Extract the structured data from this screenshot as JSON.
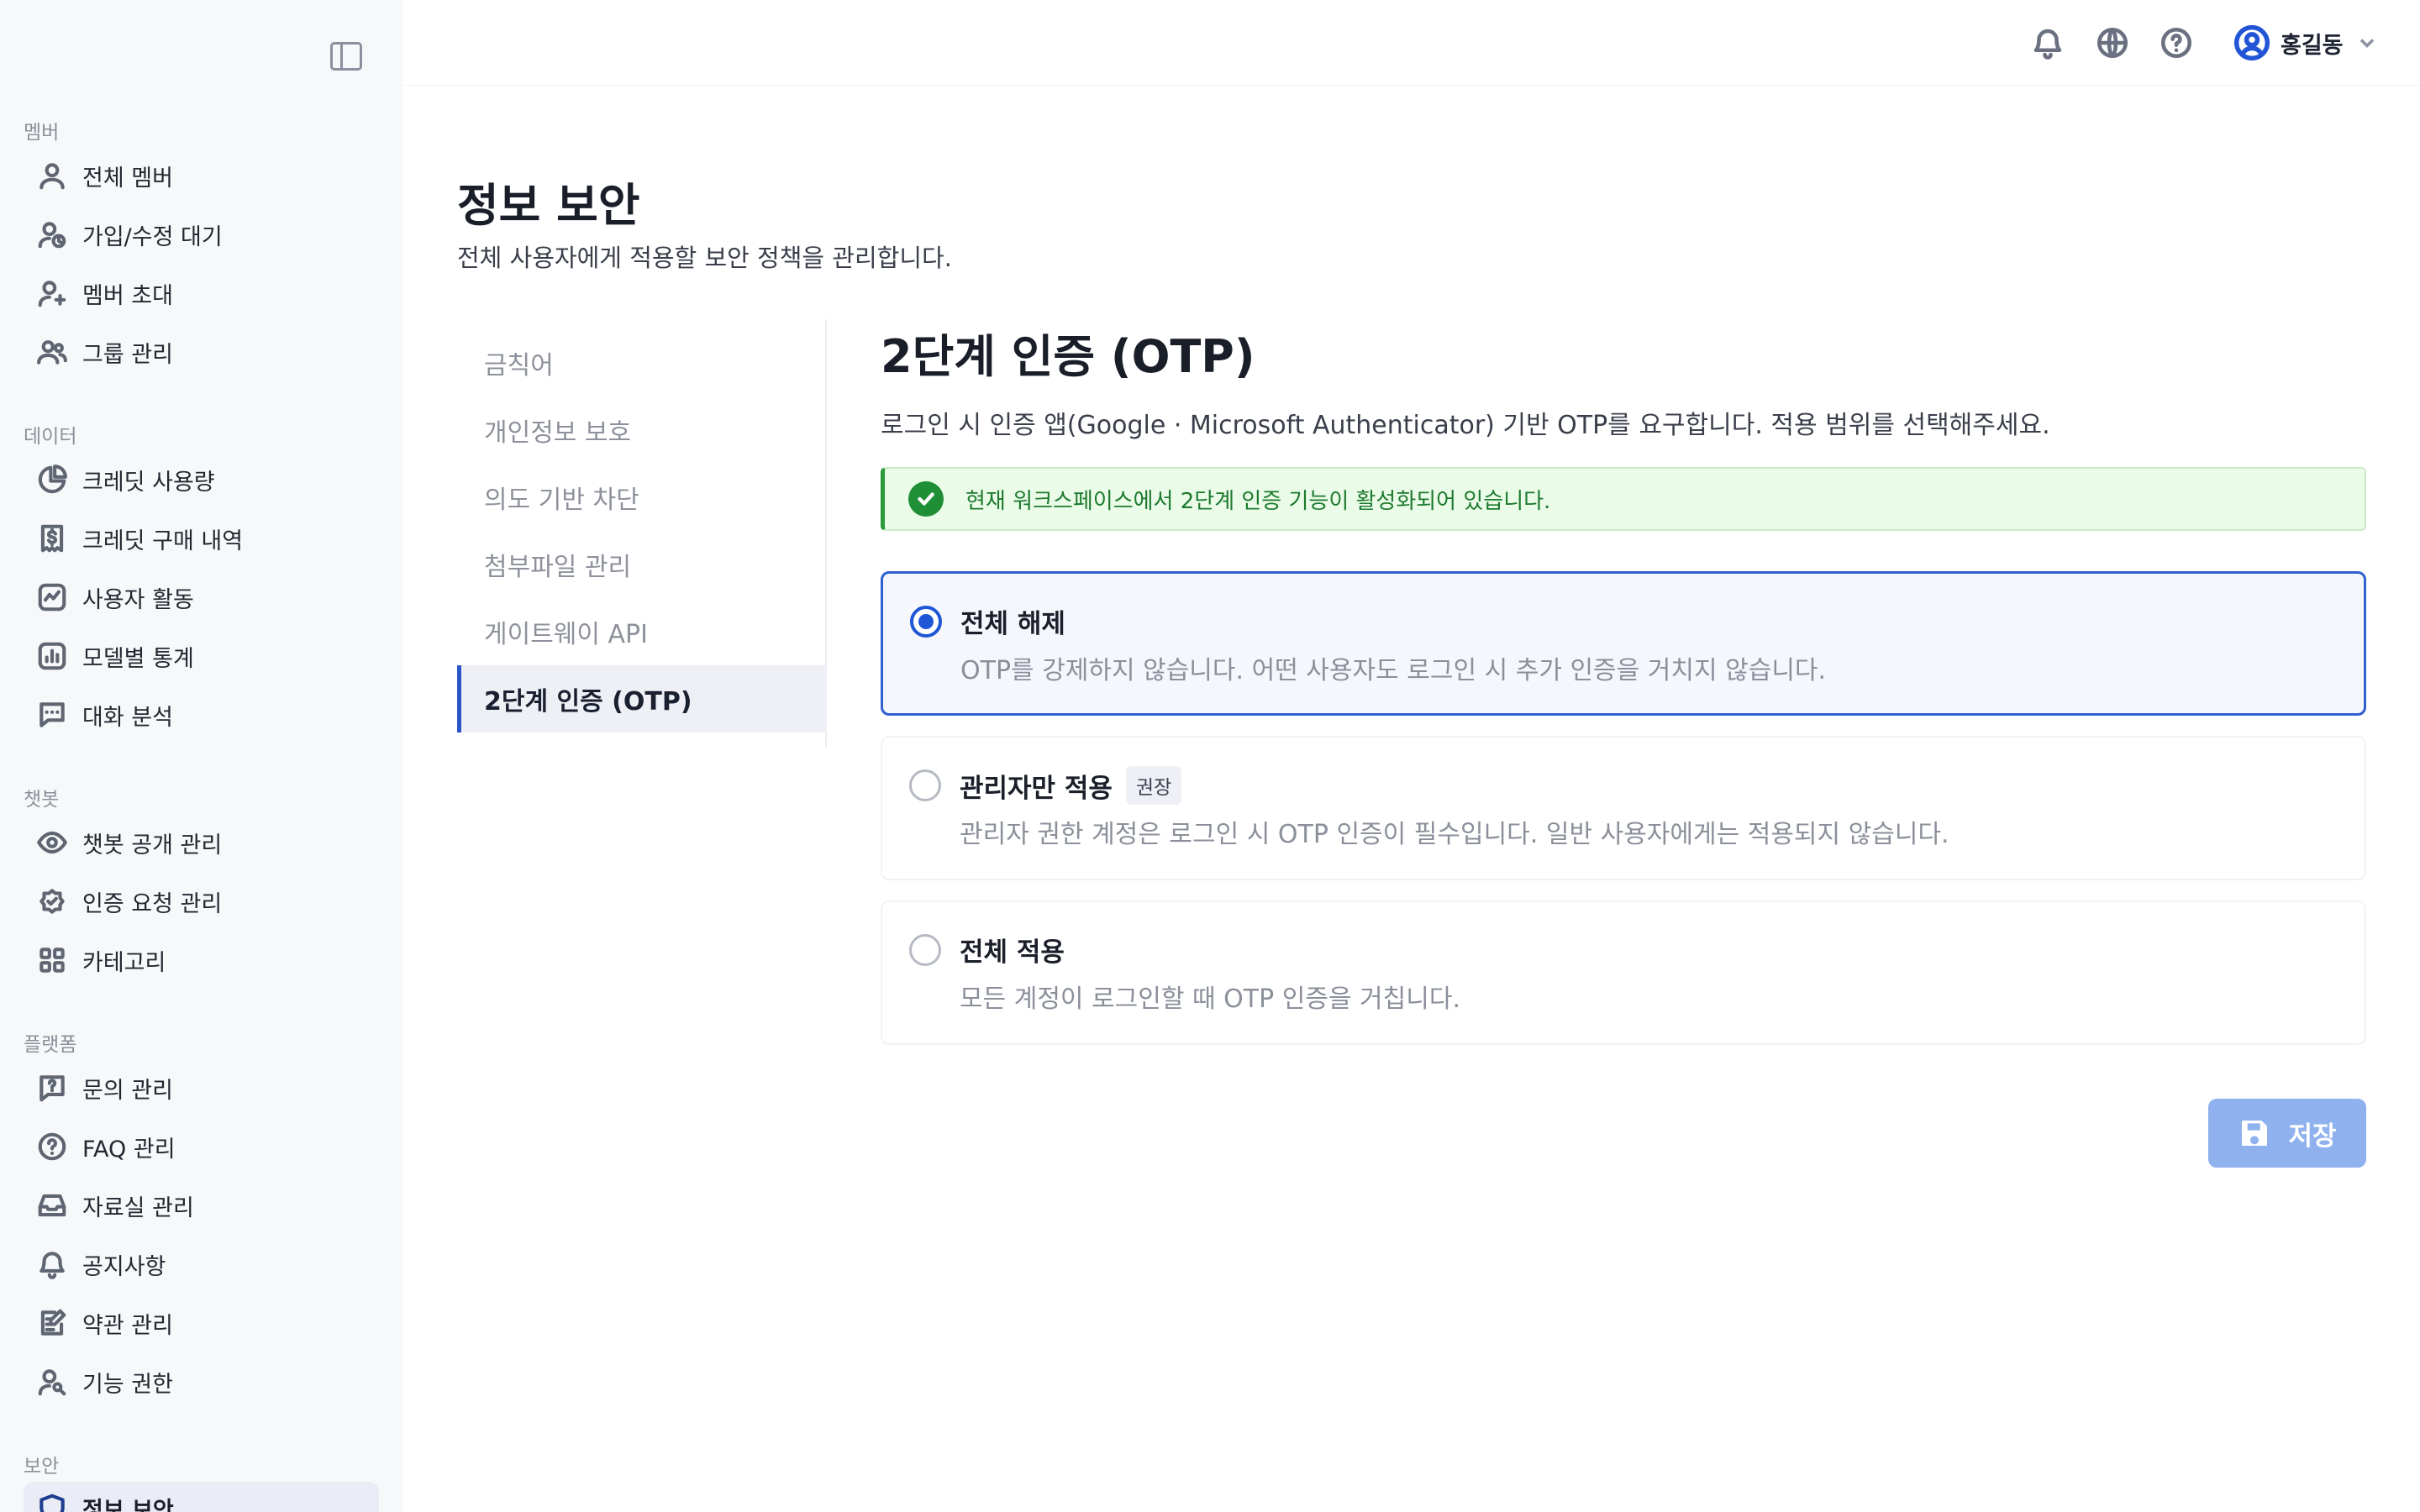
{
  "sidebar": {
    "sections": [
      {
        "title": "멤버",
        "items": [
          {
            "label": "전체 멤버",
            "icon": "user-icon"
          },
          {
            "label": "가입/수정 대기",
            "icon": "user-clock-icon"
          },
          {
            "label": "멤버 초대",
            "icon": "user-plus-icon"
          },
          {
            "label": "그룹 관리",
            "icon": "users-icon"
          }
        ]
      },
      {
        "title": "데이터",
        "items": [
          {
            "label": "크레딧 사용량",
            "icon": "pie-chart-icon"
          },
          {
            "label": "크레딧 구매 내역",
            "icon": "receipt-dollar-icon"
          },
          {
            "label": "사용자 활동",
            "icon": "activity-icon"
          },
          {
            "label": "모델별 통계",
            "icon": "bar-chart-icon"
          },
          {
            "label": "대화 분석",
            "icon": "chat-analysis-icon"
          }
        ]
      },
      {
        "title": "챗봇",
        "items": [
          {
            "label": "챗봇 공개 관리",
            "icon": "eye-icon"
          },
          {
            "label": "인증 요청 관리",
            "icon": "badge-check-icon"
          },
          {
            "label": "카테고리",
            "icon": "grid-icon"
          }
        ]
      },
      {
        "title": "플랫폼",
        "items": [
          {
            "label": "문의 관리",
            "icon": "message-question-icon"
          },
          {
            "label": "FAQ 관리",
            "icon": "help-circle-icon"
          },
          {
            "label": "자료실 관리",
            "icon": "inbox-icon"
          },
          {
            "label": "공지사항",
            "icon": "bell-icon"
          },
          {
            "label": "약관 관리",
            "icon": "edit-document-icon"
          },
          {
            "label": "기능 권한",
            "icon": "user-key-icon"
          }
        ]
      },
      {
        "title": "보안",
        "items": [
          {
            "label": "정보 보안",
            "icon": "shield-icon",
            "active": true
          }
        ]
      }
    ]
  },
  "topbar": {
    "user_name": "홍길동"
  },
  "page": {
    "title": "정보 보안",
    "description": "전체 사용자에게 적용할 보안 정책을 관리합니다."
  },
  "subnav": {
    "items": [
      "금칙어",
      "개인정보 보호",
      "의도 기반 차단",
      "첨부파일 관리",
      "게이트웨이 API",
      "2단계 인증 (OTP)"
    ],
    "active_index": 5
  },
  "content": {
    "title": "2단계 인증 (OTP)",
    "description": "로그인 시 인증 앱(Google · Microsoft Authenticator) 기반 OTP를 요구합니다. 적용 범위를 선택해주세요.",
    "alert": "현재 워크스페이스에서 2단계 인증 기능이 활성화되어 있습니다.",
    "options": [
      {
        "title": "전체 해제",
        "description": "OTP를 강제하지 않습니다. 어떤 사용자도 로그인 시 추가 인증을 거치지 않습니다.",
        "selected": true
      },
      {
        "title": "관리자만 적용",
        "badge": "권장",
        "description": "관리자 권한 계정은 로그인 시 OTP 인증이 필수입니다. 일반 사용자에게는 적용되지 않습니다.",
        "selected": false
      },
      {
        "title": "전체 적용",
        "description": "모든 계정이 로그인할 때 OTP 인증을 거칩니다.",
        "selected": false
      }
    ],
    "save_label": "저장"
  },
  "colors": {
    "accent": "#1e56d6",
    "save_disabled": "#8fb1ee",
    "success": "#1f8f35",
    "success_bg": "#eafbe8"
  }
}
